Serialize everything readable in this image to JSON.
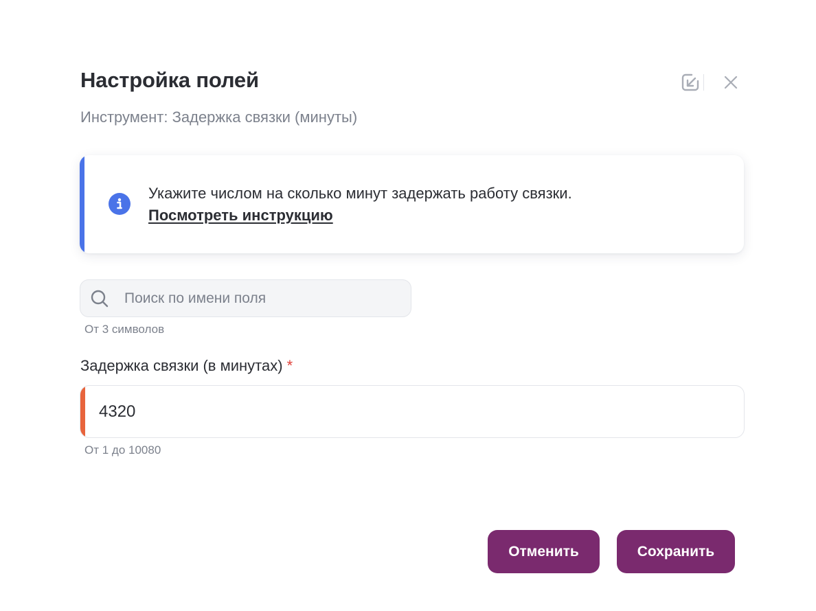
{
  "dialog": {
    "title": "Настройка полей",
    "subtitle": "Инструмент: Задержка связки (минуты)",
    "icons": {
      "collapse": "arrow-up-left-box-icon",
      "close": "close-icon"
    }
  },
  "info": {
    "icon": "info-icon",
    "text": "Укажите числом на сколько минут задержать работу связки.",
    "link": "Посмотреть инструкцию",
    "accent_color": "#4a73e8"
  },
  "search": {
    "icon": "search-icon",
    "placeholder": "Поиск по имени поля",
    "value": "",
    "hint": "От 3 символов"
  },
  "field": {
    "label": "Задержка связки (в минутах)",
    "required_mark": "*",
    "value": "4320",
    "hint": "От 1 до 10080",
    "accent_color": "#e8643c"
  },
  "buttons": {
    "cancel_label": "Отменить",
    "save_label": "Сохранить",
    "color": "#7a2a6e"
  }
}
